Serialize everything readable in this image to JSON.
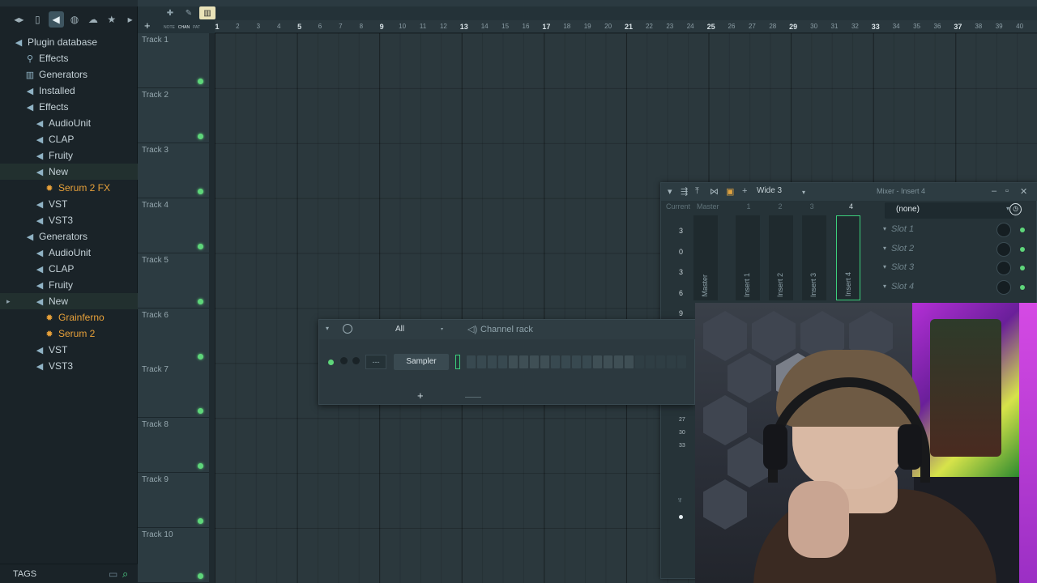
{
  "browser": {
    "toolbar_icons": [
      "back-icon",
      "forward-icon",
      "file-icon",
      "plugin-icon",
      "globe-icon",
      "cloud-icon",
      "star-icon",
      "more-icon"
    ],
    "tree": [
      {
        "label": "Plugin database",
        "level": 0,
        "icon": "plug-icon"
      },
      {
        "label": "Effects",
        "level": 1,
        "icon": "effects-icon"
      },
      {
        "label": "Generators",
        "level": 1,
        "icon": "generators-icon"
      },
      {
        "label": "Installed",
        "level": 1,
        "icon": "folder-icon"
      },
      {
        "label": "Effects",
        "level": 2,
        "icon": "folder-icon"
      },
      {
        "label": "AudioUnit",
        "level": 3,
        "icon": "folder-icon"
      },
      {
        "label": "CLAP",
        "level": 3,
        "icon": "folder-icon"
      },
      {
        "label": "Fruity",
        "level": 3,
        "icon": "folder-icon"
      },
      {
        "label": "New",
        "level": 3,
        "icon": "folder-icon",
        "highlight": true
      },
      {
        "label": "Serum 2 FX",
        "level": 4,
        "icon": "plugin-gear-icon",
        "plugin": true
      },
      {
        "label": "VST",
        "level": 3,
        "icon": "folder-icon"
      },
      {
        "label": "VST3",
        "level": 3,
        "icon": "folder-icon"
      },
      {
        "label": "Generators",
        "level": 2,
        "icon": "folder-icon"
      },
      {
        "label": "AudioUnit",
        "level": 3,
        "icon": "folder-icon"
      },
      {
        "label": "CLAP",
        "level": 3,
        "icon": "folder-icon"
      },
      {
        "label": "Fruity",
        "level": 3,
        "icon": "folder-icon"
      },
      {
        "label": "New",
        "level": 3,
        "icon": "folder-icon",
        "highlight": true,
        "arrow": true
      },
      {
        "label": "Grainferno",
        "level": 4,
        "icon": "plugin-gear-icon",
        "plugin": true
      },
      {
        "label": "Serum 2",
        "level": 4,
        "icon": "plugin-gear-icon",
        "plugin": true
      },
      {
        "label": "VST",
        "level": 3,
        "icon": "folder-icon"
      },
      {
        "label": "VST3",
        "level": 3,
        "icon": "folder-icon"
      }
    ],
    "footer": {
      "tags_label": "TAGS"
    }
  },
  "playlist": {
    "modes": [
      "NOTE",
      "CHAN",
      "PAT"
    ],
    "active_mode": "CHAN",
    "ruler_ticks": [
      "1",
      "2",
      "3",
      "4",
      "5",
      "6",
      "7",
      "8",
      "9",
      "10",
      "11",
      "12",
      "13",
      "14",
      "15",
      "16",
      "17",
      "18",
      "19",
      "20",
      "21",
      "22",
      "23",
      "24",
      "25",
      "26",
      "27",
      "28",
      "29",
      "30",
      "31",
      "32",
      "33",
      "34",
      "35",
      "36",
      "37",
      "38",
      "39",
      "40"
    ],
    "tracks": [
      "Track 1",
      "Track 2",
      "Track 3",
      "Track 4",
      "Track 5",
      "Track 6",
      "Track 7",
      "Track 8",
      "Track 9",
      "Track 10"
    ]
  },
  "mixer": {
    "preset": "Wide 3",
    "title": "Mixer - Insert 4",
    "tabs": [
      "Current",
      "Master",
      "1",
      "2",
      "3"
    ],
    "selected_number": "4",
    "strips": [
      "Master",
      "Insert 1",
      "Insert 2",
      "Insert 3",
      "Insert 4"
    ],
    "meter_numbers": [
      "3",
      "0",
      "3",
      "6",
      "9"
    ],
    "side_numbers": [
      "27",
      "30",
      "33"
    ],
    "slot_select_value": "(none)",
    "slots": [
      "Slot 1",
      "Slot 2",
      "Slot 3",
      "Slot 4"
    ]
  },
  "channel_rack": {
    "filter": "All",
    "title": "Channel rack",
    "route_label": "---",
    "channel_name": "Sampler",
    "steps": 21
  },
  "colors": {
    "accent_green": "#5ed67a",
    "plugin_orange": "#e8a13a"
  }
}
